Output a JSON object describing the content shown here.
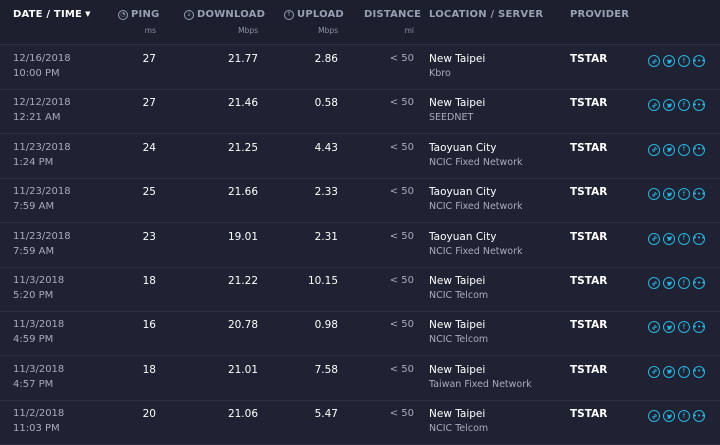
{
  "header": {
    "date_time": "DATE / TIME",
    "ping": "PING",
    "download": "DOWNLOAD",
    "upload": "UPLOAD",
    "distance": "DISTANCE",
    "location": "LOCATION / SERVER",
    "provider": "PROVIDER",
    "ping_unit": "ms",
    "download_unit": "Mbps",
    "upload_unit": "Mbps",
    "distance_unit": "mi"
  },
  "colors": {
    "background": "#1f2232",
    "accent": "#2bb3e0",
    "muted_text": "#a7abbd"
  },
  "icons": {
    "sort": "caret-down-icon",
    "actions": [
      "link-icon",
      "twitter-icon",
      "facebook-icon",
      "more-icon"
    ]
  },
  "rows": [
    {
      "date": "12/16/2018",
      "time": "10:00 PM",
      "ping": "27",
      "download": "21.77",
      "upload": "2.86",
      "distance": "< 50",
      "location": "New Taipei",
      "server": "Kbro",
      "provider": "TSTAR"
    },
    {
      "date": "12/12/2018",
      "time": "12:21 AM",
      "ping": "27",
      "download": "21.46",
      "upload": "0.58",
      "distance": "< 50",
      "location": "New Taipei",
      "server": "SEEDNET",
      "provider": "TSTAR"
    },
    {
      "date": "11/23/2018",
      "time": "1:24 PM",
      "ping": "24",
      "download": "21.25",
      "upload": "4.43",
      "distance": "< 50",
      "location": "Taoyuan City",
      "server": "NCIC Fixed Network",
      "provider": "TSTAR"
    },
    {
      "date": "11/23/2018",
      "time": "7:59 AM",
      "ping": "25",
      "download": "21.66",
      "upload": "2.33",
      "distance": "< 50",
      "location": "Taoyuan City",
      "server": "NCIC Fixed Network",
      "provider": "TSTAR"
    },
    {
      "date": "11/23/2018",
      "time": "7:59 AM",
      "ping": "23",
      "download": "19.01",
      "upload": "2.31",
      "distance": "< 50",
      "location": "Taoyuan City",
      "server": "NCIC Fixed Network",
      "provider": "TSTAR"
    },
    {
      "date": "11/3/2018",
      "time": "5:20 PM",
      "ping": "18",
      "download": "21.22",
      "upload": "10.15",
      "distance": "< 50",
      "location": "New Taipei",
      "server": "NCIC Telcom",
      "provider": "TSTAR"
    },
    {
      "date": "11/3/2018",
      "time": "4:59 PM",
      "ping": "16",
      "download": "20.78",
      "upload": "0.98",
      "distance": "< 50",
      "location": "New Taipei",
      "server": "NCIC Telcom",
      "provider": "TSTAR"
    },
    {
      "date": "11/3/2018",
      "time": "4:57 PM",
      "ping": "18",
      "download": "21.01",
      "upload": "7.58",
      "distance": "< 50",
      "location": "New Taipei",
      "server": "Taiwan Fixed Network",
      "provider": "TSTAR"
    },
    {
      "date": "11/2/2018",
      "time": "11:03 PM",
      "ping": "20",
      "download": "21.06",
      "upload": "5.47",
      "distance": "< 50",
      "location": "New Taipei",
      "server": "NCIC Telcom",
      "provider": "TSTAR"
    }
  ]
}
